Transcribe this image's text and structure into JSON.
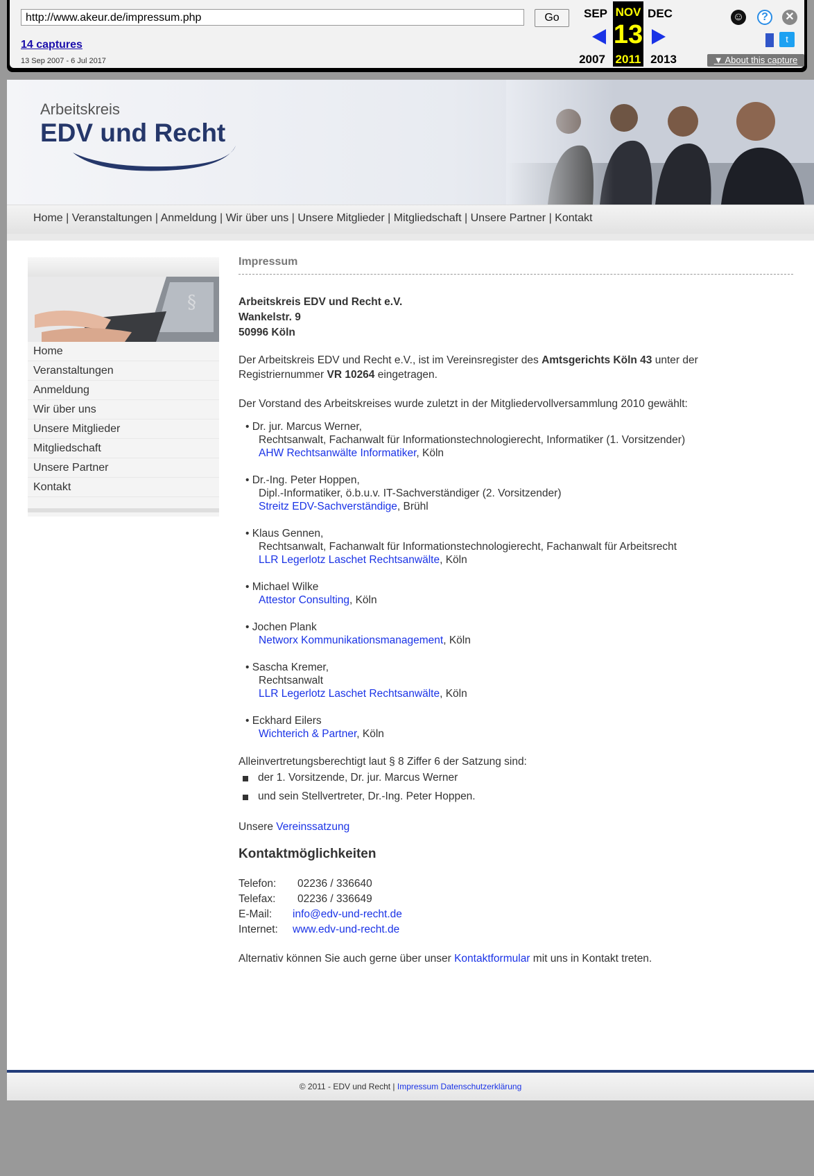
{
  "wayback": {
    "url": "http://www.akeur.de/impressum.php",
    "go": "Go",
    "captures": "14 captures",
    "range": "13 Sep 2007 - 6 Jul 2017",
    "prev_month": "SEP",
    "cur_month": "NOV",
    "next_month": "DEC",
    "day": "13",
    "prev_year": "2007",
    "cur_year": "2011",
    "next_year": "2013",
    "about": "About this capture"
  },
  "header": {
    "logo_small": "Arbeitskreis",
    "logo_big": "EDV und Recht",
    "brand_color": "#25376a"
  },
  "nav": [
    "Home",
    "Veranstaltungen",
    "Anmeldung",
    "Wir über uns",
    "Unsere Mitglieder",
    "Mitgliedschaft",
    "Unsere Partner",
    "Kontakt"
  ],
  "sidebar": [
    "Home",
    "Veranstaltungen",
    "Anmeldung",
    "Wir über uns",
    "Unsere Mitglieder",
    "Mitgliedschaft",
    "Unsere Partner",
    "Kontakt"
  ],
  "content": {
    "title": "Impressum",
    "addr1": "Arbeitskreis EDV und Recht e.V.",
    "addr2": "Wankelstr. 9",
    "addr3": "50996 Köln",
    "reg_a": "Der Arbeitskreis EDV und Recht e.V., ist im Vereinsregister des ",
    "reg_b": "Amtsgerichts Köln 43",
    "reg_c": " unter der",
    "reg_d": "Registriernummer ",
    "reg_e": "VR 10264",
    "reg_f": " eingetragen.",
    "vorstand_intro": "Der Vorstand des Arbeitskreises wurde zuletzt in der Mitgliedervollversammlung 2010 gewählt:",
    "members": [
      {
        "name": "• Dr. jur. Marcus Werner,",
        "role": "Rechtsanwalt, Fachanwalt für Informationstechnologierecht, Informatiker (1. Vorsitzender)",
        "link": "AHW Rechtsanwälte Informatiker",
        "city": ", Köln"
      },
      {
        "name": "• Dr.-Ing. Peter Hoppen,",
        "role": "Dipl.-Informatiker, ö.b.u.v. IT-Sachverständiger (2. Vorsitzender)",
        "link": "Streitz EDV-Sachverständige",
        "city": ", Brühl"
      },
      {
        "name": "• Klaus Gennen,",
        "role": "Rechtsanwalt, Fachanwalt für Informationstechnologierecht, Fachanwalt für Arbeitsrecht",
        "link": "LLR Legerlotz Laschet Rechtsanwälte",
        "city": ", Köln"
      },
      {
        "name": "• Michael Wilke",
        "link": "Attestor Consulting",
        "city": ", Köln"
      },
      {
        "name": "• Jochen Plank",
        "link": "Networx Kommunikationsmanagement",
        "city": ", Köln"
      },
      {
        "name": "• Sascha Kremer,",
        "role": "Rechtsanwalt",
        "link": "LLR Legerlotz Laschet Rechtsanwälte",
        "city": ", Köln"
      },
      {
        "name": "• Eckhard Eilers",
        "link": "Wichterich & Partner",
        "city": ", Köln"
      }
    ],
    "allein": "Alleinvertretungsberechtigt laut § 8 Ziffer 6 der Satzung sind:",
    "allein1": "der 1. Vorsitzende, Dr. jur. Marcus Werner",
    "allein2": "und sein Stellvertreter, Dr.-Ing. Peter Hoppen.",
    "satzung_a": "Unsere ",
    "satzung_link": "Vereinssatzung",
    "kontakt_title": "Kontaktmöglichkeiten",
    "tel_label": "Telefon:",
    "tel": "02236 / 336640",
    "fax_label": "Telefax:",
    "fax": "02236 / 336649",
    "mail_label": "E-Mail:",
    "mail": "info@edv-und-recht.de",
    "web_label": "Internet:",
    "web": "www.edv-und-recht.de",
    "alt_a": "Alternativ können Sie auch gerne über unser ",
    "alt_link": "Kontaktformular",
    "alt_b": " mit uns in Kontakt treten."
  },
  "footer": {
    "copy": "© 2011 - EDV und Recht | ",
    "impressum": "Impressum",
    "datenschutz": "Datenschutzerklärung"
  }
}
